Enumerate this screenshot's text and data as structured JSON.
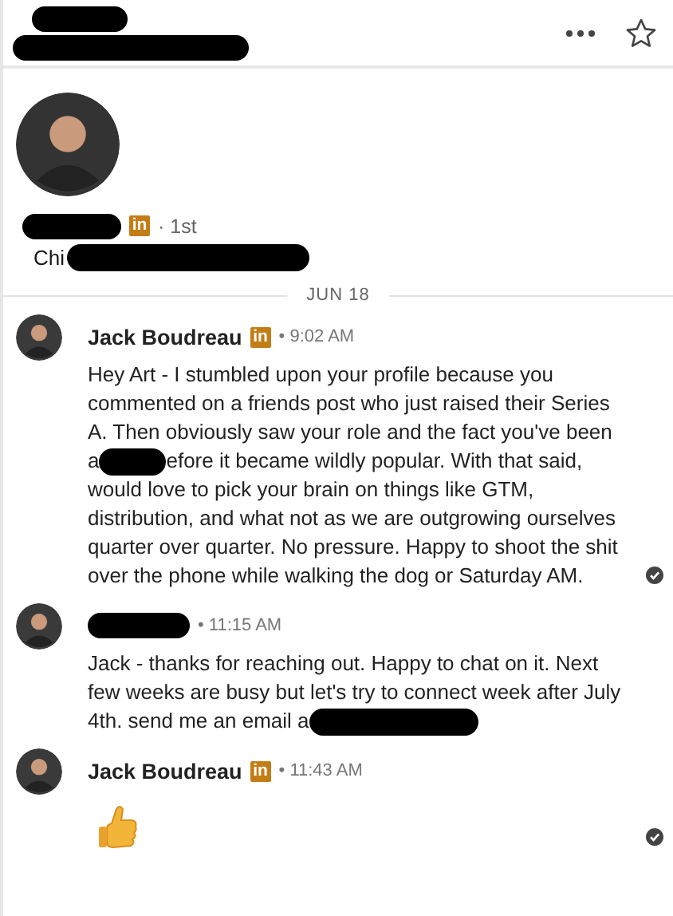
{
  "header": {
    "starred": false
  },
  "profile": {
    "badge": "in",
    "degree": "· 1st",
    "headline": "Chi"
  },
  "date_divider": "JUN 18",
  "messages": [
    {
      "sender": "Jack Boudreau",
      "badge": "in",
      "time": "• 9:02 AM",
      "read": true,
      "body": {
        "kind": "text",
        "text": "Hey Art - I stumbled upon your profile because you commented on a friends post who just raised their Series A. Then obviously saw your role and the fact you've been a",
        "after_redaction": "efore it became wildly popular. With that said, would love to pick your brain on things like GTM, distribution, and what not as we are outgrowing ourselves quarter over quarter. No pressure. Happy to shoot the shit over the phone while walking the dog or Saturday AM."
      }
    },
    {
      "time": "• 11:15 AM",
      "read": false,
      "body": {
        "kind": "text",
        "text": "Jack - thanks for reaching out. Happy to chat on it. Next few weeks are busy but let's try to connect week after July 4th. send me an email a"
      }
    },
    {
      "sender": "Jack Boudreau",
      "badge": "in",
      "time": "• 11:43 AM",
      "read": true,
      "body": {
        "kind": "thumbs-up"
      }
    }
  ]
}
